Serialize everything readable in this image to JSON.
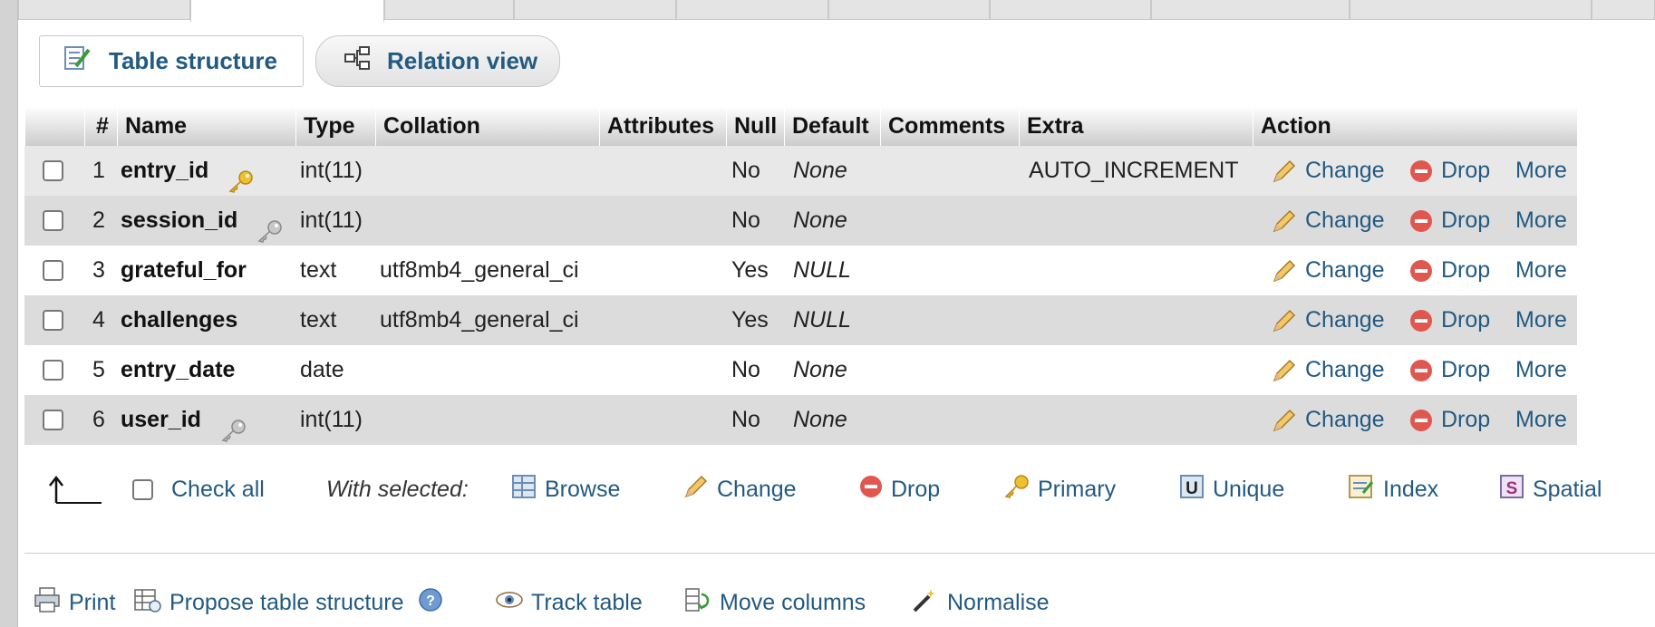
{
  "views": {
    "structure_label": "Table structure",
    "relation_label": "Relation view"
  },
  "columns": {
    "num": "#",
    "name": "Name",
    "type": "Type",
    "collation": "Collation",
    "attributes": "Attributes",
    "null": "Null",
    "default": "Default",
    "comments": "Comments",
    "extra": "Extra",
    "action": "Action"
  },
  "rows": [
    {
      "num": "1",
      "name": "entry_id",
      "type": "int(11)",
      "collation": "",
      "null": "No",
      "default": "None",
      "extra": "AUTO_INCREMENT",
      "key": "primary"
    },
    {
      "num": "2",
      "name": "session_id",
      "type": "int(11)",
      "collation": "",
      "null": "No",
      "default": "None",
      "extra": "",
      "key": "index"
    },
    {
      "num": "3",
      "name": "grateful_for",
      "type": "text",
      "collation": "utf8mb4_general_ci",
      "null": "Yes",
      "default": "NULL",
      "extra": "",
      "key": ""
    },
    {
      "num": "4",
      "name": "challenges",
      "type": "text",
      "collation": "utf8mb4_general_ci",
      "null": "Yes",
      "default": "NULL",
      "extra": "",
      "key": ""
    },
    {
      "num": "5",
      "name": "entry_date",
      "type": "date",
      "collation": "",
      "null": "No",
      "default": "None",
      "extra": "",
      "key": ""
    },
    {
      "num": "6",
      "name": "user_id",
      "type": "int(11)",
      "collation": "",
      "null": "No",
      "default": "None",
      "extra": "",
      "key": "index"
    }
  ],
  "row_actions": {
    "change": "Change",
    "drop": "Drop",
    "more": "More"
  },
  "bulk": {
    "check_all": "Check all",
    "with_selected": "With selected:",
    "browse": "Browse",
    "change": "Change",
    "drop": "Drop",
    "primary": "Primary",
    "unique": "Unique",
    "index": "Index",
    "spatial": "Spatial"
  },
  "footer": {
    "print": "Print",
    "propose": "Propose table structure",
    "track": "Track table",
    "move": "Move columns",
    "normalise": "Normalise"
  },
  "colors": {
    "link": "#235a81",
    "header_top": "#ffffff",
    "header_bottom": "#cccccc",
    "row_light": "#e8e8e8",
    "row_dark": "#dcdcdc",
    "drop_red": "#e0574f",
    "key_gold": "#e6b422"
  }
}
